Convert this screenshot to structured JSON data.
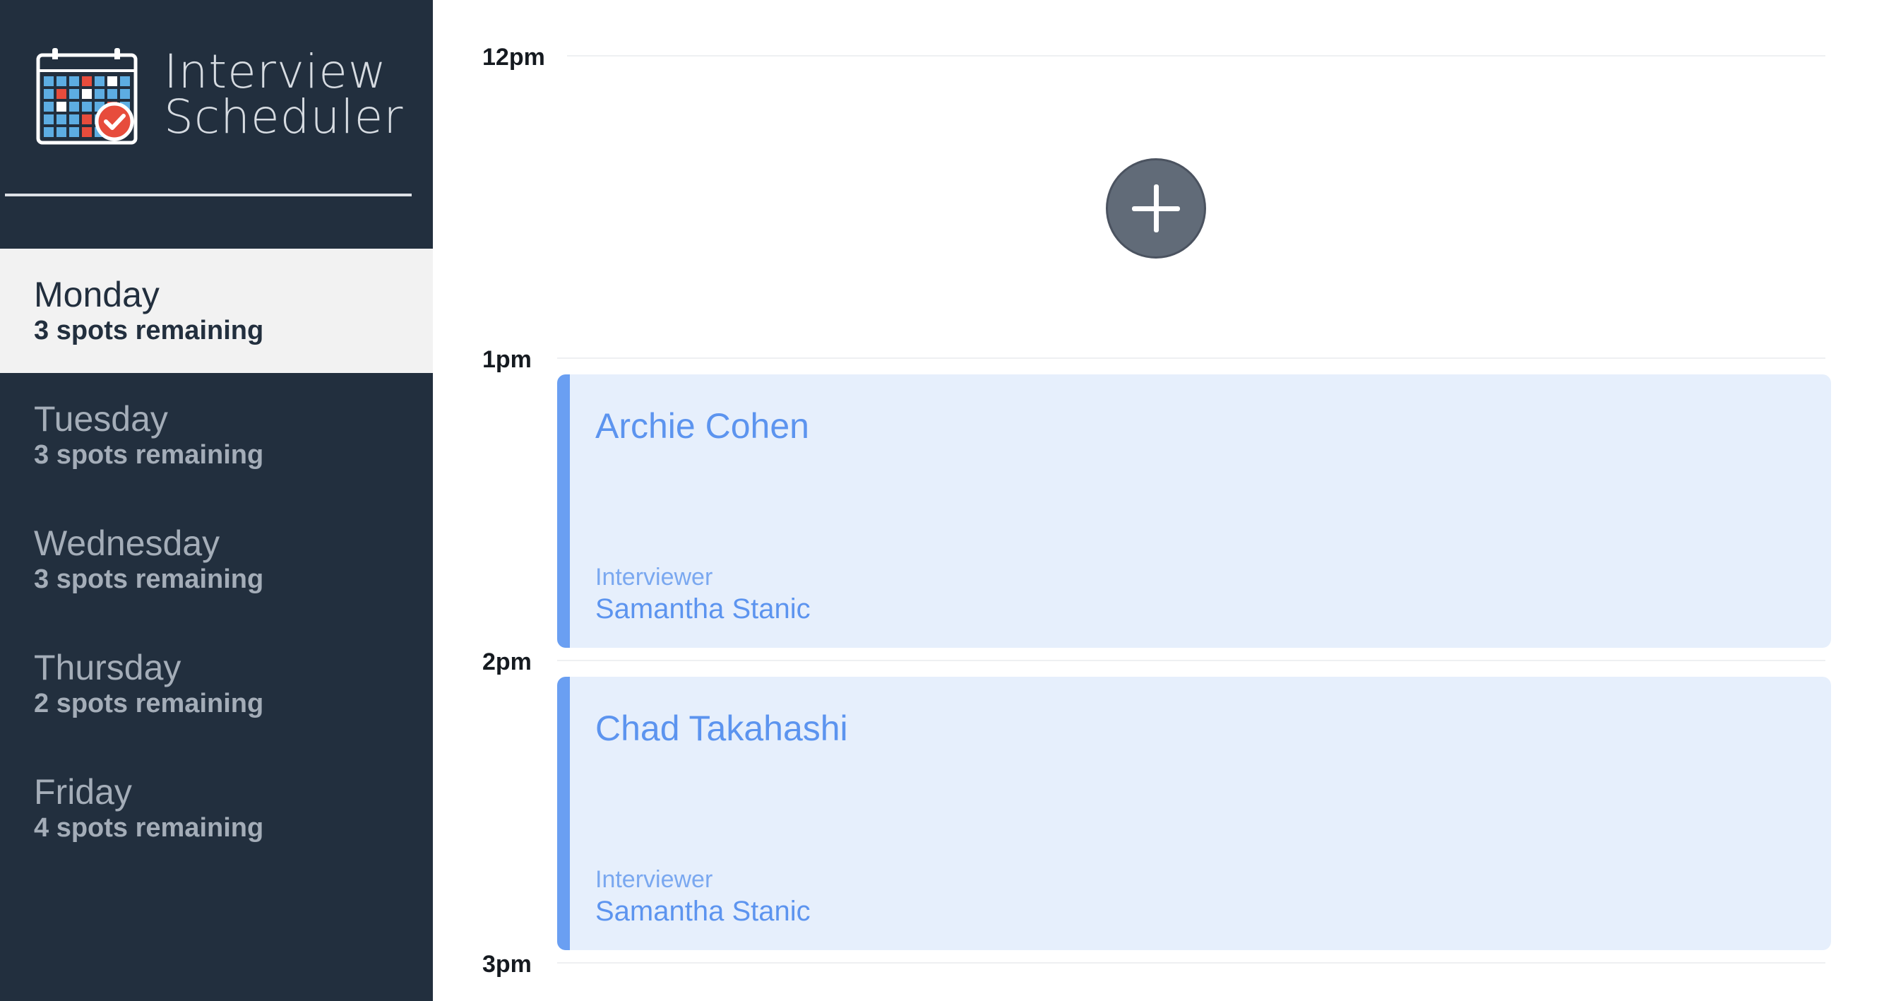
{
  "app": {
    "title_line1": "Interview",
    "title_line2": "Scheduler"
  },
  "days": [
    {
      "name": "Monday",
      "spots": "3 spots remaining",
      "selected": true
    },
    {
      "name": "Tuesday",
      "spots": "3 spots remaining",
      "selected": false
    },
    {
      "name": "Wednesday",
      "spots": "3 spots remaining",
      "selected": false
    },
    {
      "name": "Thursday",
      "spots": "2 spots remaining",
      "selected": false
    },
    {
      "name": "Friday",
      "spots": "4 spots remaining",
      "selected": false
    }
  ],
  "schedule": {
    "times": [
      "12pm",
      "1pm",
      "2pm",
      "3pm"
    ],
    "appointments": [
      {
        "student": "Archie Cohen",
        "interviewer_label": "Interviewer",
        "interviewer": "Samantha Stanic"
      },
      {
        "student": "Chad Takahashi",
        "interviewer_label": "Interviewer",
        "interviewer": "Samantha Stanic"
      }
    ]
  },
  "colors": {
    "sidebar": "#222f3e",
    "selected_day_bg": "#f2f2f2",
    "appointment_bg": "#e6effc",
    "appointment_accent": "#6a9ff2",
    "add_button": "#616b78"
  },
  "icons": {
    "logo": "calendar-check-icon",
    "add": "plus-icon"
  }
}
